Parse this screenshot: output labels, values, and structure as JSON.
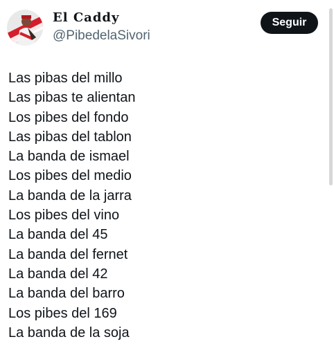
{
  "author": {
    "display_name": "El Caddy",
    "handle": "@PibedelaSivori"
  },
  "follow_button": {
    "label": "Seguir"
  },
  "tweet": {
    "lines": [
      "Las pibas del millo",
      "Las pibas te alientan",
      "Los pibes del fondo",
      "Las pibas del tablon",
      "La banda de ismael",
      "Los pibes del medio",
      "La banda de la jarra",
      "Los pibes del vino",
      "La banda del 45",
      "La banda del fernet",
      "La banda del 42",
      "La banda del barro",
      "Los pibes del 169",
      "La banda de la soja"
    ]
  },
  "colors": {
    "text": "#0f1419",
    "secondary_text": "#536471",
    "button_bg": "#0f1419",
    "button_text": "#ffffff",
    "avatar_red": "#d41e2b",
    "scrollbar": "#d7d7d7"
  },
  "icons": {
    "avatar": "profile-picture"
  }
}
